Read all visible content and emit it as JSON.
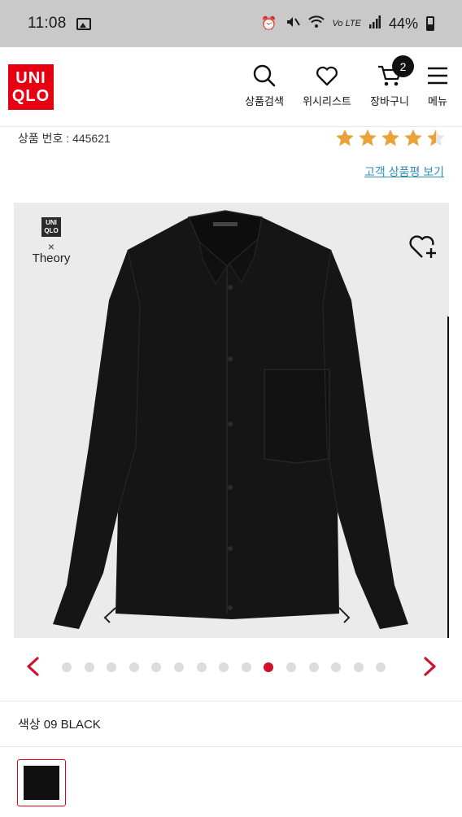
{
  "status_bar": {
    "time": "11:08",
    "signal_text": "Vo LTE",
    "battery": "44%",
    "icons": [
      "gallery-icon",
      "alarm-icon",
      "mute-icon",
      "wifi-icon",
      "signal-icon",
      "battery-icon"
    ]
  },
  "header": {
    "logo_line1": "UNI",
    "logo_line2": "QLO",
    "brand_color": "#e60012",
    "nav": {
      "search": "상품검색",
      "wishlist": "위시리스트",
      "cart": "장바구니",
      "cart_count": "2",
      "menu": "메뉴"
    }
  },
  "product": {
    "number_label": "상품 번호 : 445621",
    "rating": 4.5,
    "star_color": "#e8a33a",
    "review_link": "고객 상품평 보기",
    "collab": {
      "logo_line1": "UNI",
      "logo_line2": "QLO",
      "x": "×",
      "partner": "Theory"
    },
    "image_subject": "black oversized long-sleeve shirt"
  },
  "carousel": {
    "total": 15,
    "active_index": 9,
    "active_color": "#d0112b"
  },
  "color": {
    "label": "색상 09 BLACK",
    "swatch_color": "#111111",
    "swatch_border": "#e60012"
  }
}
